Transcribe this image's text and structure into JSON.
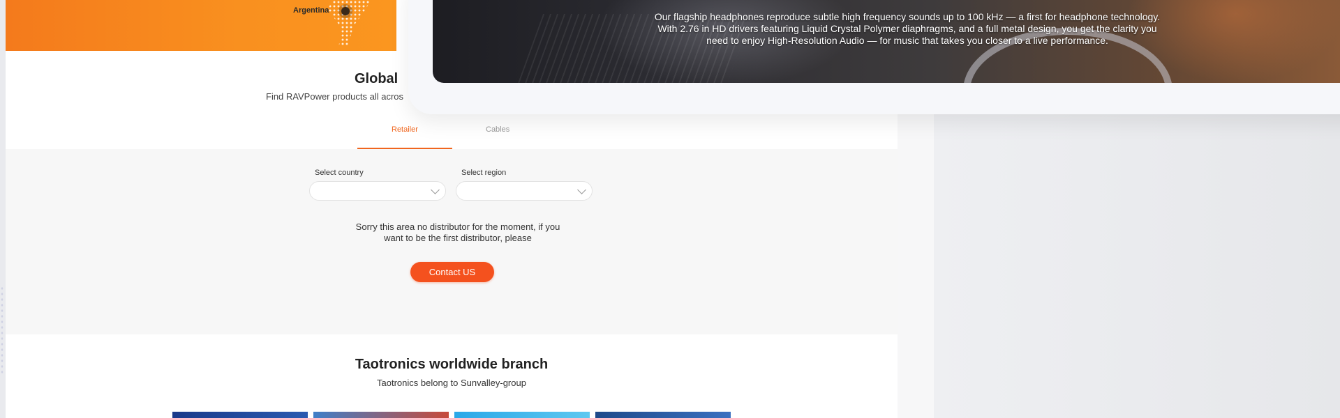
{
  "map": {
    "country_label": "Argentina",
    "accent": "#f47a1c"
  },
  "global_section": {
    "title": "Global",
    "subtitle": "Find RAVPower products all acros"
  },
  "tabs": [
    {
      "label": "Retailer",
      "active": true
    },
    {
      "label": "Cables",
      "active": false
    }
  ],
  "filters": {
    "country_label": "Select country",
    "country_value": "",
    "region_label": "Select region",
    "region_value": ""
  },
  "notice": {
    "line1": "Sorry this area no distributor for the moment, if you",
    "line2": "want to be the first distributor, please",
    "button": "Contact US",
    "button_color": "#f4511e"
  },
  "branch": {
    "title": "Taotronics worldwide branch",
    "subtitle": "Taotronics belong to Sunvalley-group"
  },
  "video": {
    "title": "",
    "description": "Our flagship headphones reproduce subtle high frequency sounds up to 100 kHz — a first for headphone technology. With 2.76 in HD drivers featuring Liquid Crystal Polymer diaphragms, and a full metal design, you get the clarity you need to enjoy High-Resolution Audio — for music that takes you closer to a live performance."
  },
  "icons": {
    "select_chevron": "chevron-down-icon",
    "map_marker": "location-pin-icon"
  }
}
